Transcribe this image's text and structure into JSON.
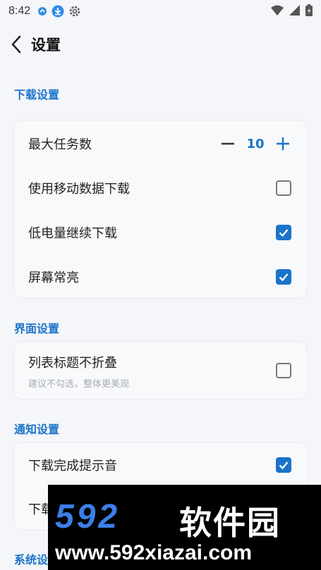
{
  "status_bar": {
    "time": "8:42",
    "icons": [
      "app-notification-icon",
      "download-icon",
      "settings-icon"
    ],
    "right_icons": [
      "wifi-icon",
      "signal-icon",
      "battery-icon"
    ]
  },
  "header": {
    "title": "设置"
  },
  "sections": {
    "download": {
      "title": "下载设置",
      "max_tasks_label": "最大任务数",
      "max_tasks_value": "10",
      "mobile_data_label": "使用移动数据下载",
      "mobile_data_checked": false,
      "low_battery_label": "低电量继续下载",
      "low_battery_checked": true,
      "screen_on_label": "屏幕常亮",
      "screen_on_checked": true
    },
    "interface": {
      "title": "界面设置",
      "fold_title_label": "列表标题不折叠",
      "fold_title_sub": "建议不勾选，整体更美观",
      "fold_title_checked": false
    },
    "notify": {
      "title": "通知设置",
      "sound_label": "下载完成提示音",
      "sound_checked": true,
      "second_label_partial": "下载"
    },
    "system": {
      "title_partial": "系统设"
    }
  },
  "watermark": {
    "brand_num": "592",
    "brand_cn": "软件园",
    "url": "www.592xiazai.com"
  },
  "colors": {
    "accent": "#1a73c9",
    "background": "#f4f6f9"
  }
}
